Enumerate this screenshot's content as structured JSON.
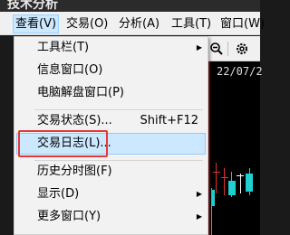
{
  "window": {
    "title_fragment": "技术分析"
  },
  "menubar": {
    "items": [
      {
        "label": "查看(V)",
        "active": true
      },
      {
        "label": "交易(O)"
      },
      {
        "label": "分析(A)"
      },
      {
        "label": "工具(T)"
      },
      {
        "label": "窗口(W)"
      }
    ]
  },
  "toolbar": {
    "icons": [
      "zoom-out-icon",
      "settings-icon"
    ]
  },
  "chart": {
    "date_text": "22/07/2"
  },
  "view_menu": {
    "items": [
      {
        "label": "工具栏(T)",
        "shortcut": "",
        "submenu": true
      },
      {
        "label": "信息窗口(O)",
        "shortcut": "",
        "submenu": false
      },
      {
        "label": "电脑解盘窗口(P)",
        "shortcut": "",
        "submenu": false
      },
      {
        "label": "交易状态(S)...",
        "shortcut": "Shift+F12",
        "submenu": false
      },
      {
        "label": "交易日志(L)...",
        "shortcut": "",
        "submenu": false,
        "highlighted": true
      },
      {
        "label": "历史分时图(F)",
        "shortcut": "",
        "submenu": false
      },
      {
        "label": "显示(D)",
        "shortcut": "",
        "submenu": true
      },
      {
        "label": "更多窗口(Y)",
        "shortcut": "",
        "submenu": true
      }
    ]
  },
  "colors": {
    "highlight_bg": "#cce8ff",
    "annotation": "#e23a3a",
    "candle_up": "#e03030",
    "candle_down": "#20d0d0"
  }
}
